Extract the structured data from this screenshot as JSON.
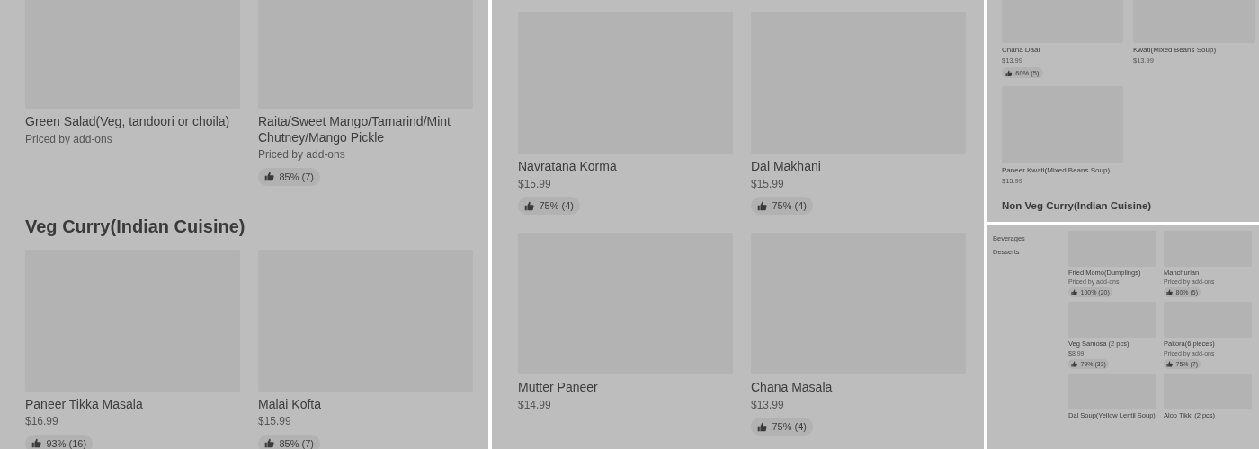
{
  "panels": [
    {
      "sections": [
        {
          "kind": "grid",
          "items": [
            {
              "name": "Green Salad(Veg, tandoori or choila)",
              "price": "Priced by add-ons"
            },
            {
              "name": "Raita/Sweet Mango/Tamarind/Mint Chutney/Mango Pickle",
              "price": "Priced by add-ons",
              "rating": "85% (7)"
            }
          ]
        },
        {
          "kind": "heading",
          "title": "Veg Curry(Indian Cuisine)"
        },
        {
          "kind": "grid",
          "items": [
            {
              "name": "Paneer Tikka Masala",
              "price": "$16.99",
              "rating": "93% (16)"
            },
            {
              "name": "Malai Kofta",
              "price": "$15.99",
              "rating": "85% (7)"
            }
          ]
        }
      ]
    },
    {
      "sections": [
        {
          "kind": "grid",
          "items": [
            {
              "name": "Navratana Korma",
              "price": "$15.99",
              "rating": "75% (4)"
            },
            {
              "name": "Dal Makhani",
              "price": "$15.99",
              "rating": "75% (4)"
            },
            {
              "name": "Mutter Paneer",
              "price": "$14.99"
            },
            {
              "name": "Chana Masala",
              "price": "$13.99",
              "rating": "75% (4)"
            }
          ]
        }
      ]
    },
    {
      "sections": [
        {
          "kind": "grid",
          "items": [
            {
              "name": "Chana Daal",
              "price": "$13.99",
              "rating": "60% (5)"
            },
            {
              "name": "Kwati(Mixed Beans Soup)",
              "price": "$13.99"
            },
            {
              "name": "Paneer Kwati(Mixed Beans Soup)",
              "price": "$15.99"
            }
          ]
        },
        {
          "kind": "heading",
          "title": "Non Veg Curry(Indian Cuisine)"
        }
      ]
    },
    {
      "sidebar": [
        "Beverages",
        "Desserts"
      ],
      "sections": [
        {
          "kind": "grid",
          "items": [
            {
              "name": "Fried Momo(Dumplings)",
              "price": "Priced by add-ons",
              "rating": "100% (20)"
            },
            {
              "name": "Manchurian",
              "price": "Priced by add-ons",
              "rating": "80% (5)"
            },
            {
              "name": "Veg Samosa (2 pcs)",
              "price": "$8.99",
              "rating": "79% (33)"
            },
            {
              "name": "Pakora(6 pieces)",
              "price": "Priced by add-ons",
              "rating": "75% (7)"
            },
            {
              "name": "Dal Soup(Yellow Lentil Soup)"
            },
            {
              "name": "Aloo Tikki (2 pcs)"
            }
          ]
        }
      ]
    }
  ]
}
